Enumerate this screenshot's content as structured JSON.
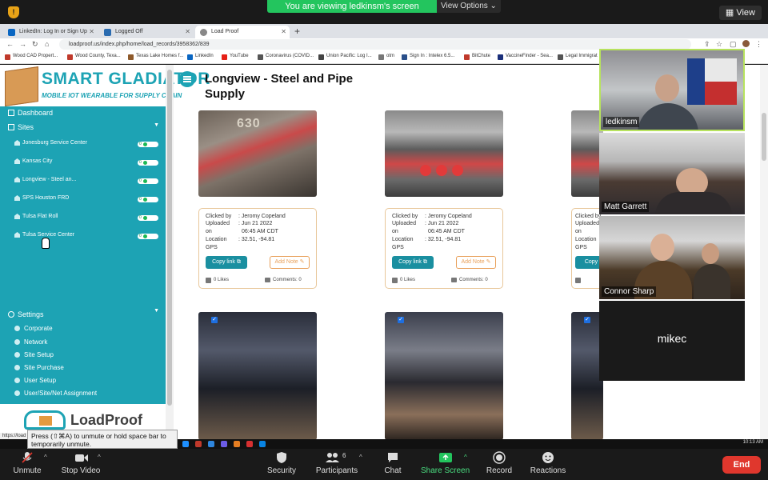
{
  "zoom": {
    "banner": "You are viewing ledkinsm's screen",
    "view_options": "View Options",
    "view_button": "View",
    "tooltip": "Press  (⇧⌘A) to unmute or hold space bar to temporarily unmute.",
    "toolbar": {
      "unmute": "Unmute",
      "stop_video": "Stop Video",
      "security": "Security",
      "participants": "Participants",
      "participant_count": "6",
      "chat": "Chat",
      "share_screen": "Share Screen",
      "record": "Record",
      "reactions": "Reactions",
      "end": "End"
    },
    "participants": [
      {
        "name": "ledkinsm"
      },
      {
        "name": "Matt Garrett"
      },
      {
        "name": "Connor Sharp"
      },
      {
        "name": "mikec"
      }
    ]
  },
  "browser": {
    "tabs": [
      {
        "label": "LinkedIn: Log In or Sign Up"
      },
      {
        "label": "Logged Off"
      },
      {
        "label": "Load Proof"
      }
    ],
    "url": "loadproof.us/index.php/home/load_records/3958362/839",
    "bookmarks": [
      "Wood CAD Propert...",
      "Wood County, Texa...",
      "Texas Lake Homes f...",
      "LinkedIn",
      "YouTube",
      "Coronavirus (COVID...",
      "Union Pacific: Log I...",
      "otm",
      "Sign In : Intelex 6.5...",
      "BitChute",
      "VaccineFinder - Sea...",
      "Legal Immigrat"
    ],
    "status_url": "https://load",
    "clock": "10:13 AM"
  },
  "sidebar": {
    "logo_title": "SMART GLADIATOR",
    "logo_sub": "MOBILE IOT WEARABLE FOR SUPPLY CHAIN",
    "dashboard": "Dashboard",
    "sites_label": "Sites",
    "sites": [
      {
        "label": "Jonesburg Service Center"
      },
      {
        "label": "Kansas City"
      },
      {
        "label": "Longview - Steel an..."
      },
      {
        "label": "SPS Houston FRD"
      },
      {
        "label": "Tulsa Flat Roll"
      },
      {
        "label": "Tulsa Service Center"
      }
    ],
    "pill_value": "0",
    "settings_label": "Settings",
    "settings": [
      {
        "label": "Corporate"
      },
      {
        "label": "Network"
      },
      {
        "label": "Site Setup"
      },
      {
        "label": "Site Purchase"
      },
      {
        "label": "User Setup"
      },
      {
        "label": "User/Site/Net Assignment"
      }
    ],
    "footer_logo": "LoadProof"
  },
  "main": {
    "title": "Longview - Steel and Pipe Supply",
    "cards": [
      {
        "clicked_by": ": Jeromy Copeland",
        "uploaded": ": Jun 21 2022",
        "uploaded_time": "06:45 AM CDT",
        "location": ": 32.51, -94.81",
        "photo_number": "630"
      },
      {
        "clicked_by": ": Jeromy Copeland",
        "uploaded": ": Jun 21 2022",
        "uploaded_time": "06:45 AM CDT",
        "location": ": 32.51, -94.81"
      },
      {
        "clicked_by": "",
        "uploaded": "",
        "uploaded_time": "",
        "location": ""
      }
    ],
    "labels": {
      "clicked_by": "Clicked by",
      "uploaded": "Uploaded",
      "on": "on",
      "location": "Location",
      "gps": "GPS",
      "copy_link": "Copy link",
      "copy_link_short": "Copy",
      "add_note": "Add Note",
      "likes": "0 Likes",
      "comments": "Comments: 0"
    }
  },
  "colors": {
    "accent": "#1da3b4",
    "banner": "#23c55e",
    "end": "#e0372d"
  }
}
